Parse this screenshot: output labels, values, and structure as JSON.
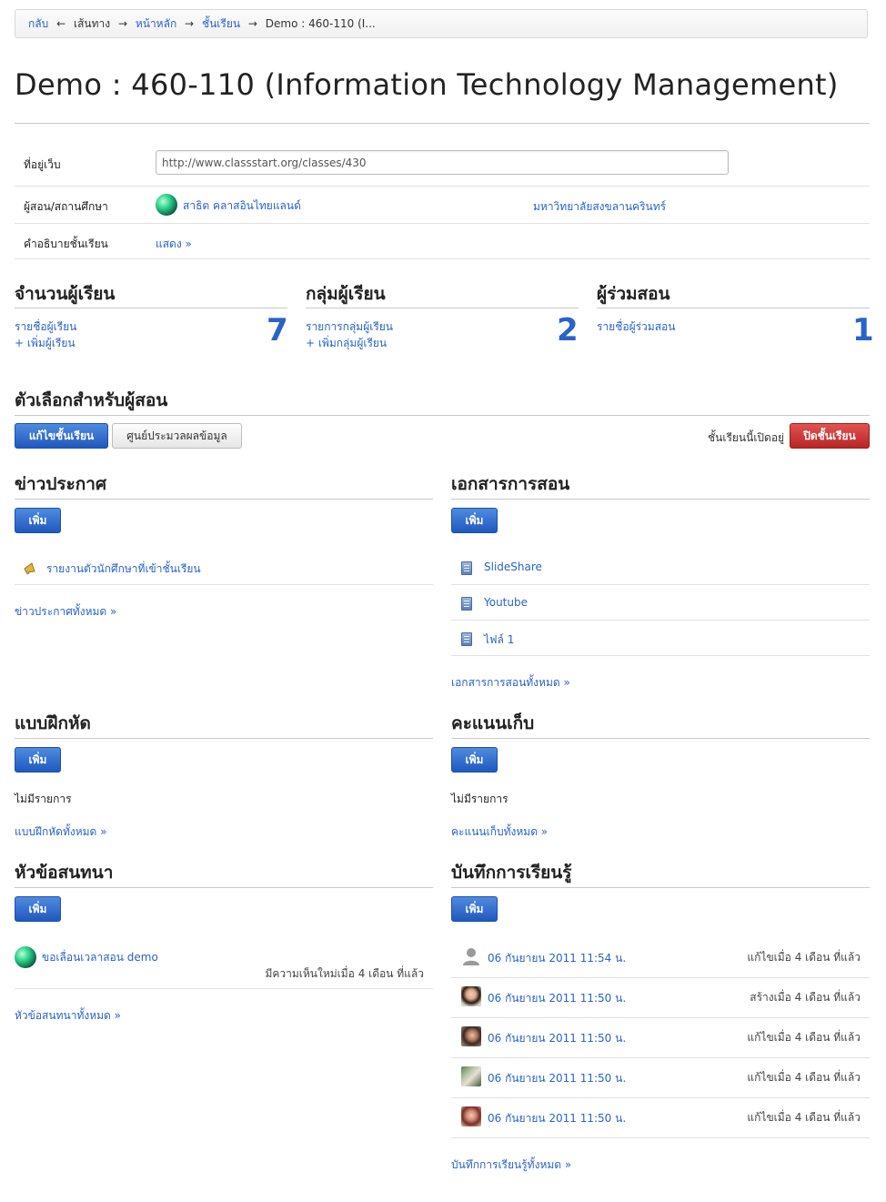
{
  "breadcrumb": {
    "back": "กลับ",
    "path_label": "เส้นทาง",
    "home": "หน้าหลัก",
    "classes": "ชั้นเรียน",
    "current": "Demo : 460-110 (I..."
  },
  "page_title": "Demo : 460-110 (Information Technology Management)",
  "info": {
    "url_label": "ที่อยู่เว็บ",
    "url_value": "http://www.classstart.org/classes/430",
    "teacher_label": "ผู้สอน/สถานศึกษา",
    "teacher_name": "สาธิต คลาสอินไทยแลนด์",
    "institution": "มหาวิทยาลัยสงขลานครินทร์",
    "desc_label": "คำอธิบายชั้นเรียน",
    "desc_link": "แสดง »"
  },
  "stats": {
    "students": {
      "title": "จำนวนผู้เรียน",
      "link1": "รายชื่อผู้เรียน",
      "link2": "+ เพิ่มผู้เรียน",
      "count": "7"
    },
    "groups": {
      "title": "กลุ่มผู้เรียน",
      "link1": "รายการกลุ่มผู้เรียน",
      "link2": "+ เพิ่มกลุ่มผู้เรียน",
      "count": "2"
    },
    "coteachers": {
      "title": "ผู้ร่วมสอน",
      "link1": "รายชื่อผู้ร่วมสอน",
      "count": "1"
    }
  },
  "options": {
    "title": "ตัวเลือกสำหรับผู้สอน",
    "edit_button": "แก้ไขชั้นเรียน",
    "data_center_button": "ศูนย์ประมวลผลข้อมูล",
    "status_text": "ชั้นเรียนนี้เปิดอยู่",
    "close_button": "ปิดชั้นเรียน"
  },
  "add_label": "เพิ่ม",
  "announcements": {
    "title": "ข่าวประกาศ",
    "items": [
      "รายงานตัวนักศึกษาที่เข้าชั้นเรียน"
    ],
    "all_link": "ข่าวประกาศทั้งหมด »"
  },
  "materials": {
    "title": "เอกสารการสอน",
    "items": [
      "SlideShare",
      "Youtube",
      "ไฟล์ 1"
    ],
    "all_link": "เอกสารการสอนทั้งหมด »"
  },
  "exercises": {
    "title": "แบบฝึกหัด",
    "empty": "ไม่มีรายการ",
    "all_link": "แบบฝึกหัดทั้งหมด »"
  },
  "scores": {
    "title": "คะแนนเก็บ",
    "empty": "ไม่มีรายการ",
    "all_link": "คะแนนเก็บทั้งหมด »"
  },
  "discussions": {
    "title": "หัวข้อสนทนา",
    "items": [
      {
        "title": "ขอเลื่อนเวลาสอน demo",
        "meta": "มีความเห็นใหม่เมื่อ 4 เดือน ที่แล้ว"
      }
    ],
    "all_link": "หัวข้อสนทนาทั้งหมด »"
  },
  "journals": {
    "title": "บันทึกการเรียนรู้",
    "items": [
      {
        "date": "06 กันยายน 2011 11:54 น.",
        "meta": "แก้ไขเมื่อ 4 เดือน ที่แล้ว"
      },
      {
        "date": "06 กันยายน 2011 11:50 น.",
        "meta": "สร้างเมื่อ 4 เดือน ที่แล้ว"
      },
      {
        "date": "06 กันยายน 2011 11:50 น.",
        "meta": "แก้ไขเมื่อ 4 เดือน ที่แล้ว"
      },
      {
        "date": "06 กันยายน 2011 11:50 น.",
        "meta": "แก้ไขเมื่อ 4 เดือน ที่แล้ว"
      },
      {
        "date": "06 กันยายน 2011 11:50 น.",
        "meta": "แก้ไขเมื่อ 4 เดือน ที่แล้ว"
      }
    ],
    "all_link": "บันทึกการเรียนรู้ทั้งหมด »"
  },
  "colors": {
    "link": "#2a62c9",
    "primary_button": "#2f66c9",
    "danger_button": "#c0302c"
  }
}
